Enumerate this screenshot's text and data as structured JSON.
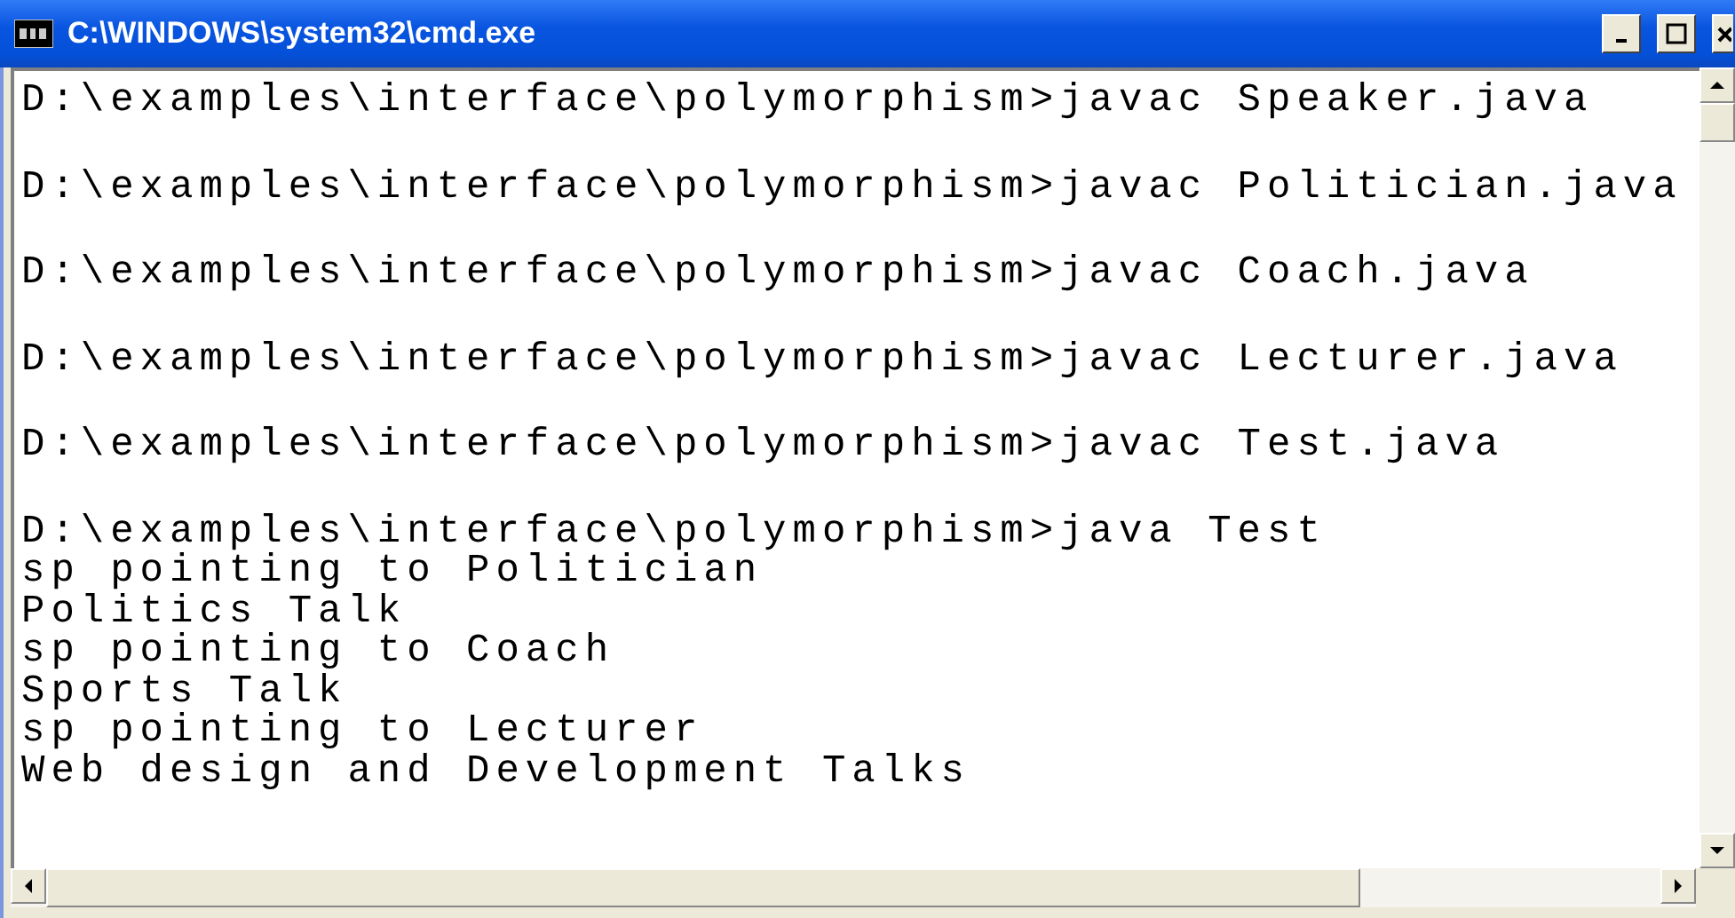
{
  "window": {
    "title": "C:\\WINDOWS\\system32\\cmd.exe"
  },
  "console": {
    "blocks": [
      {
        "lines": [
          "D:\\examples\\interface\\polymorphism>javac Speaker.java"
        ]
      },
      {
        "lines": [
          "D:\\examples\\interface\\polymorphism>javac Politician.java"
        ]
      },
      {
        "lines": [
          "D:\\examples\\interface\\polymorphism>javac Coach.java"
        ]
      },
      {
        "lines": [
          "D:\\examples\\interface\\polymorphism>javac Lecturer.java"
        ]
      },
      {
        "lines": [
          "D:\\examples\\interface\\polymorphism>javac Test.java"
        ]
      },
      {
        "lines": [
          "D:\\examples\\interface\\polymorphism>java Test",
          "sp pointing to Politician",
          "Politics Talk",
          "sp pointing to Coach",
          "Sports Talk",
          "sp pointing to Lecturer",
          "Web design and Development Talks"
        ]
      }
    ]
  }
}
